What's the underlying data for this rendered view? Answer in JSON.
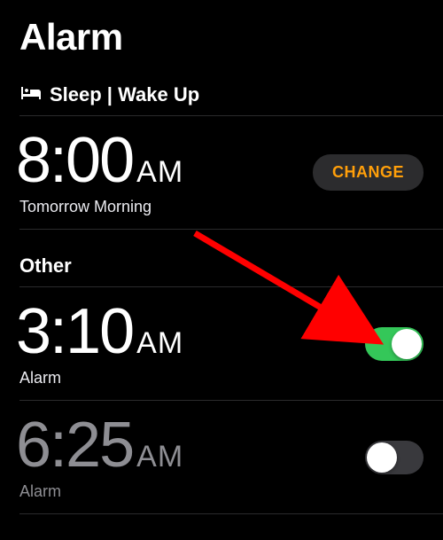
{
  "page": {
    "title": "Alarm"
  },
  "sleep_wake": {
    "header": "Sleep | Wake Up",
    "time": "8:00",
    "period": "AM",
    "subtitle": "Tomorrow Morning",
    "change_label": "CHANGE"
  },
  "other": {
    "header": "Other",
    "alarms": [
      {
        "time": "3:10",
        "period": "AM",
        "subtitle": "Alarm",
        "enabled": true
      },
      {
        "time": "6:25",
        "period": "AM",
        "subtitle": "Alarm",
        "enabled": false
      }
    ]
  },
  "colors": {
    "accent_orange": "#ff9f0a",
    "toggle_green": "#34c759",
    "annotation_red": "#ff0000"
  }
}
